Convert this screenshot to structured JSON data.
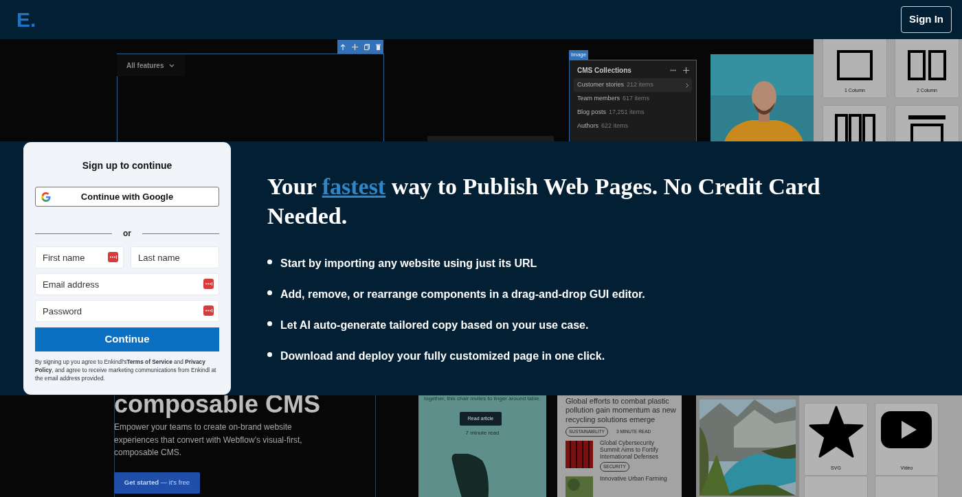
{
  "navbar": {
    "logo": "E.",
    "sign_in": "Sign In"
  },
  "backdrop": {
    "editor": {
      "dropdown": "All features",
      "image_tag": "Image",
      "cms_panel": {
        "title": "CMS Collections",
        "items": [
          {
            "name": "Customer stories",
            "count": "212 items",
            "selected": true
          },
          {
            "name": "Team members",
            "count": "617 items",
            "selected": false
          },
          {
            "name": "Blog posts",
            "count": "17,251 items",
            "selected": false
          },
          {
            "name": "Authors",
            "count": "622 items",
            "selected": false
          }
        ]
      },
      "layouts": [
        {
          "kind": "one",
          "label": "1 Column"
        },
        {
          "kind": "two",
          "label": "2 Column"
        },
        {
          "kind": "three"
        },
        {
          "kind": "header"
        }
      ]
    },
    "hero": {
      "heading": "composable CMS",
      "text": "Empower your teams to create on-brand website experiences that convert with Webflow’s visual-first, composable CMS.",
      "button": "**Get started** — it's free"
    },
    "article_card": {
      "text": "together, this chair invites to linger around table.",
      "button": "Read article",
      "read_time": "7 minute read"
    },
    "news": {
      "headline": "Global efforts to combat plastic pollution gain momentum as new recycling solutions emerge",
      "tag": "SUSTAINABILITY",
      "read_time": "3 MINUTE READ",
      "items": [
        {
          "title": "Global Cybersecurity Summit Aims to Fortify International Defenses",
          "tag": "SECURITY"
        },
        {
          "title": "Innovative Urban Farming"
        }
      ]
    },
    "elements": [
      {
        "kind": "star",
        "label": "SVG"
      },
      {
        "kind": "video",
        "label": "Video"
      },
      {
        "kind": "blank"
      },
      {
        "kind": "blank"
      }
    ]
  },
  "signup": {
    "title": "Sign up to continue",
    "google": "Continue with Google",
    "divider": "or",
    "fields": [
      {
        "placeholder": "First name",
        "autofill": true
      },
      {
        "placeholder": "Last name",
        "autofill": false
      },
      {
        "placeholder": "Email address",
        "autofill": true
      },
      {
        "placeholder": "Password",
        "autofill": true
      }
    ],
    "submit": "Continue",
    "legal": "By signing up you agree to Enkindl's**Terms of Service** and **Privacy Policy**, and agree to receive marketing communications from Enkindl at the email address provided."
  },
  "main": {
    "heading_before": "Your",
    "link": "fastest",
    "heading_after": "way to Publish Web Pages. No Credit Card Needed.",
    "bullets": [
      "Start by importing any website using just its URL",
      "Add, remove, or rearrange components in a drag-and-drop GUI editor.",
      "Let AI auto-generate tailored copy based on your use case.",
      "Download and deploy your fully customized page in one click."
    ]
  }
}
